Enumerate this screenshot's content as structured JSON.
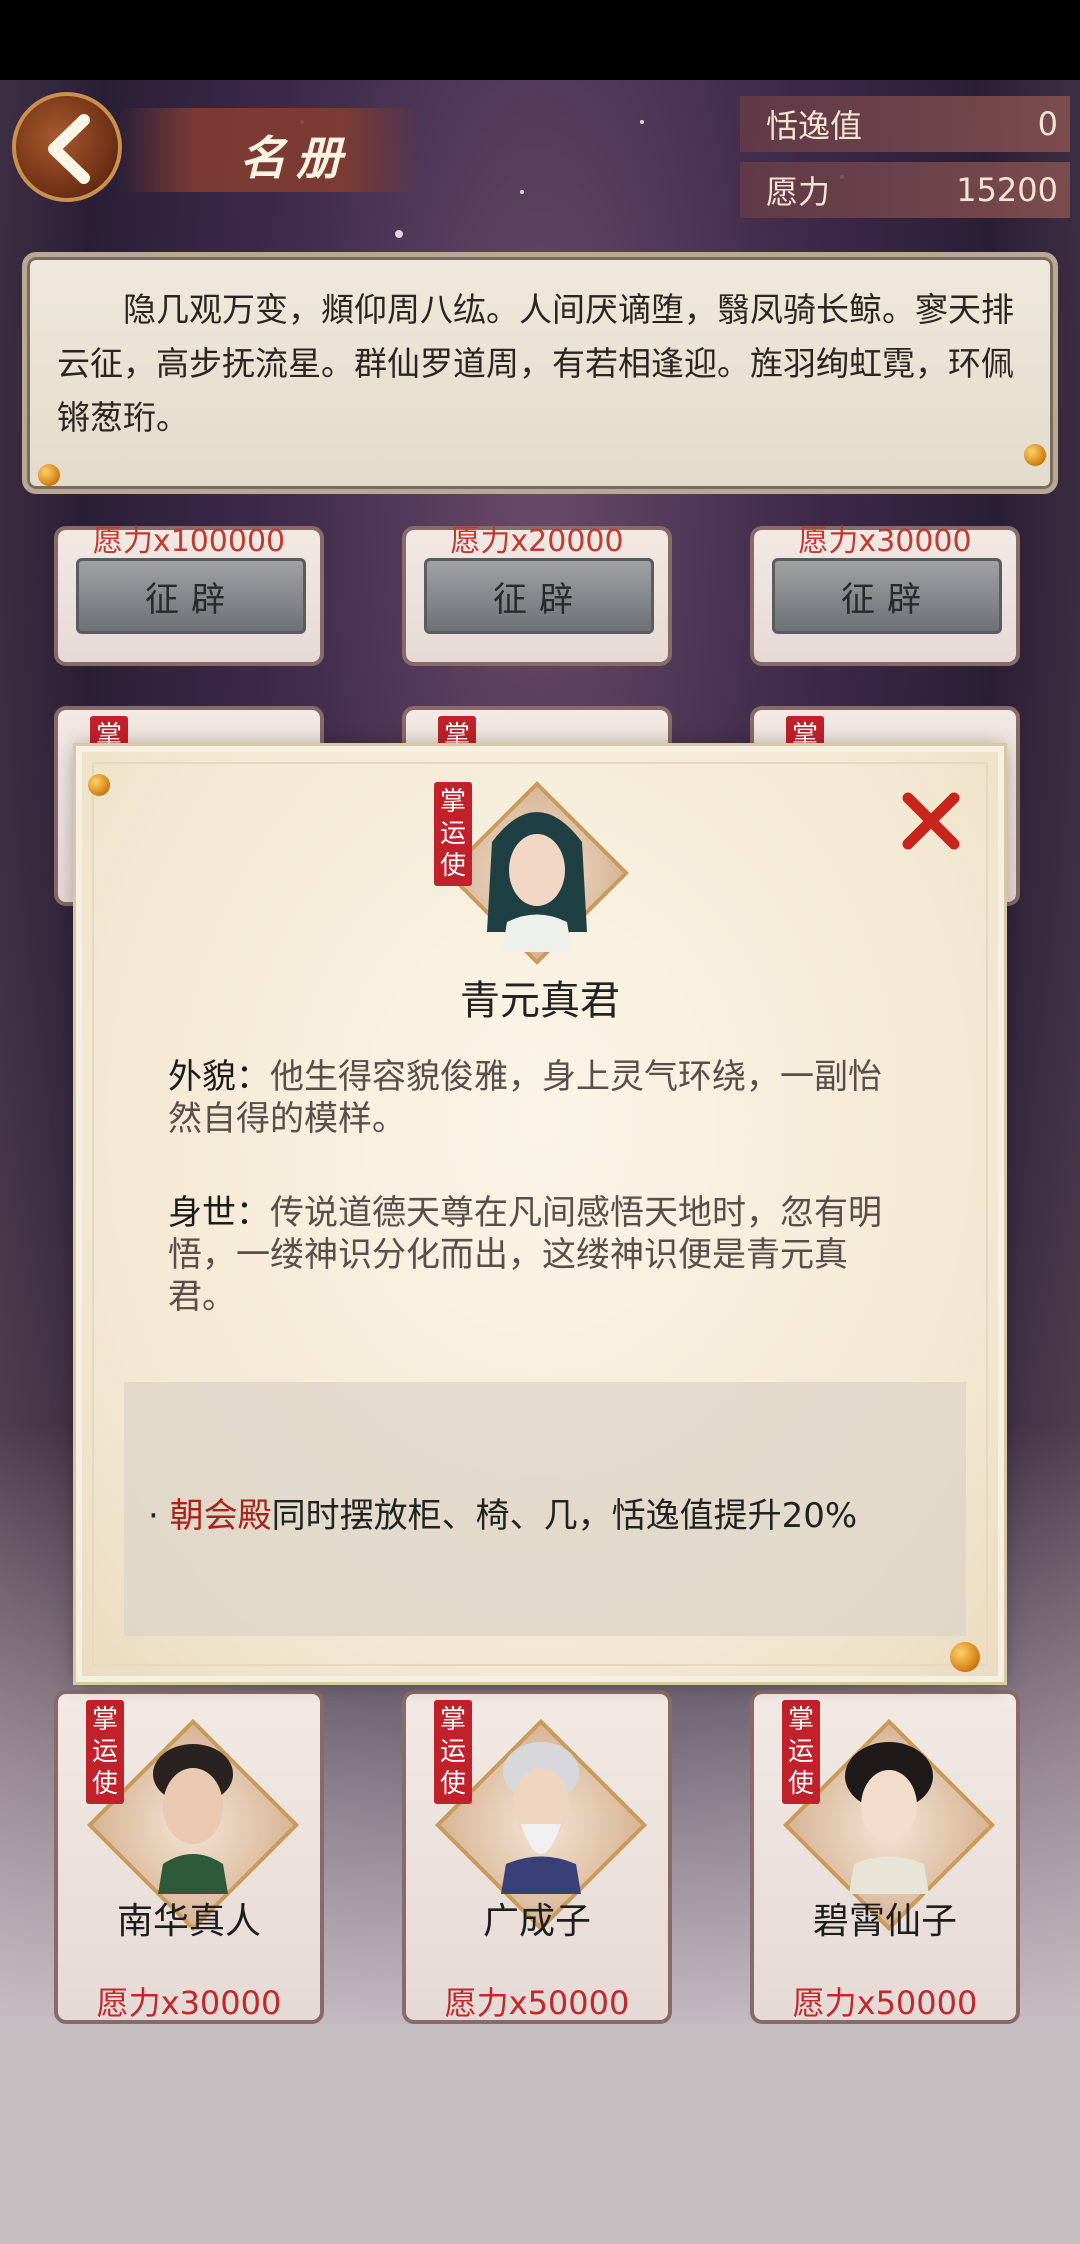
{
  "header": {
    "title": "名册",
    "stats": [
      {
        "label": "恬逸值",
        "value": "0"
      },
      {
        "label": "愿力",
        "value": "15200"
      }
    ]
  },
  "poem": "隐几观万变，頫仰周八纮。人间厌谪堕，翳凤骑长鲸。寥天排云征，高步抚流星。群仙罗道周，有若相逢迎。旌羽绚虹霓，环佩锵葱珩。",
  "top_cards": [
    {
      "cost": "愿力x100000",
      "button": "征辟"
    },
    {
      "cost": "愿力x20000",
      "button": "征辟"
    },
    {
      "cost": "愿力x30000",
      "button": "征辟"
    }
  ],
  "badge_text": "掌运使",
  "modal": {
    "name": "青元真君",
    "appearance_label": "外貌：",
    "appearance_text": "他生得容貌俊雅，身上灵气环绕，一副怡然自得的模样。",
    "background_label": "身世：",
    "background_text": "传说道德天尊在凡间感悟天地时，忽有明悟，一缕神识分化而出，这缕神识便是青元真君。",
    "bonus_prefix": "· ",
    "bonus_highlight": "朝会殿",
    "bonus_text": "同时摆放柜、椅、几，恬逸值提升20%"
  },
  "bottom_cards": [
    {
      "name": "南华真人",
      "cost": "愿力x30000"
    },
    {
      "name": "广成子",
      "cost": "愿力x50000"
    },
    {
      "name": "碧霄仙子",
      "cost": "愿力x50000"
    }
  ],
  "colors": {
    "accent_red": "#c2282a",
    "badge_red": "#c0212a"
  }
}
